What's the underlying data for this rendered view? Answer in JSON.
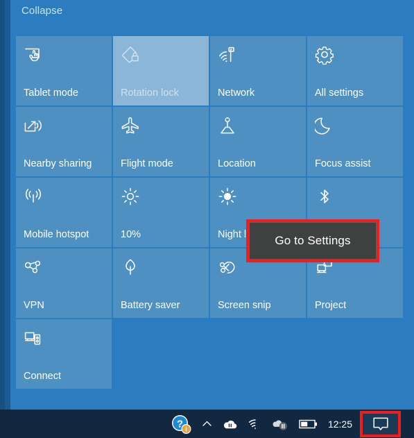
{
  "window": {
    "name": "Windows Action Center",
    "panel_bg": "#2b7cc0",
    "tile_bg": "#4e90c2",
    "tile_disabled_bg": "#8cb6d8",
    "taskbar_bg": "#122740",
    "highlight_color": "#f41b1b"
  },
  "action_center": {
    "collapse_label": "Collapse",
    "tiles": [
      [
        {
          "label": "Tablet mode",
          "icon": "tablet-mode-icon",
          "state": "enabled"
        },
        {
          "label": "Rotation lock",
          "icon": "rotation-lock-icon",
          "state": "disabled"
        },
        {
          "label": "Network",
          "icon": "network-icon",
          "state": "enabled"
        },
        {
          "label": "All settings",
          "icon": "gear-icon",
          "state": "enabled"
        }
      ],
      [
        {
          "label": "Nearby sharing",
          "icon": "nearby-sharing-icon",
          "state": "enabled"
        },
        {
          "label": "Flight mode",
          "icon": "airplane-icon",
          "state": "enabled"
        },
        {
          "label": "Location",
          "icon": "location-icon",
          "state": "enabled"
        },
        {
          "label": "Focus assist",
          "icon": "moon-icon",
          "state": "enabled"
        }
      ],
      [
        {
          "label": "Mobile hotspot",
          "icon": "hotspot-icon",
          "state": "enabled"
        },
        {
          "label": "10%",
          "icon": "brightness-icon",
          "state": "enabled"
        },
        {
          "label": "Night light",
          "icon": "sun-icon",
          "state": "enabled"
        },
        {
          "label": "",
          "icon": "bluetooth-icon",
          "state": "enabled"
        }
      ],
      [
        {
          "label": "VPN",
          "icon": "vpn-icon",
          "state": "enabled"
        },
        {
          "label": "Battery saver",
          "icon": "leaf-icon",
          "state": "enabled"
        },
        {
          "label": "Screen snip",
          "icon": "scissors-icon",
          "state": "enabled"
        },
        {
          "label": "Project",
          "icon": "project-icon",
          "state": "enabled"
        }
      ],
      [
        {
          "label": "Connect",
          "icon": "connect-icon",
          "state": "enabled"
        },
        {
          "label": "",
          "icon": "",
          "state": "placeholder"
        },
        {
          "label": "",
          "icon": "",
          "state": "placeholder"
        },
        {
          "label": "",
          "icon": "",
          "state": "placeholder"
        }
      ]
    ]
  },
  "tooltip": {
    "text": "Go to Settings",
    "border_color": "#f41b1b",
    "background": "#3f4141"
  },
  "taskbar": {
    "tray": [
      {
        "name": "help-notification-icon",
        "label": ""
      },
      {
        "name": "show-hidden-icons-chevron-icon",
        "label": ""
      },
      {
        "name": "onedrive-paused-icon",
        "label": ""
      },
      {
        "name": "wifi-icon",
        "label": ""
      },
      {
        "name": "volume-muted-icon",
        "label": ""
      },
      {
        "name": "battery-icon",
        "label": ""
      }
    ],
    "clock": "12:25",
    "action_center_icon": "action-center-icon"
  }
}
